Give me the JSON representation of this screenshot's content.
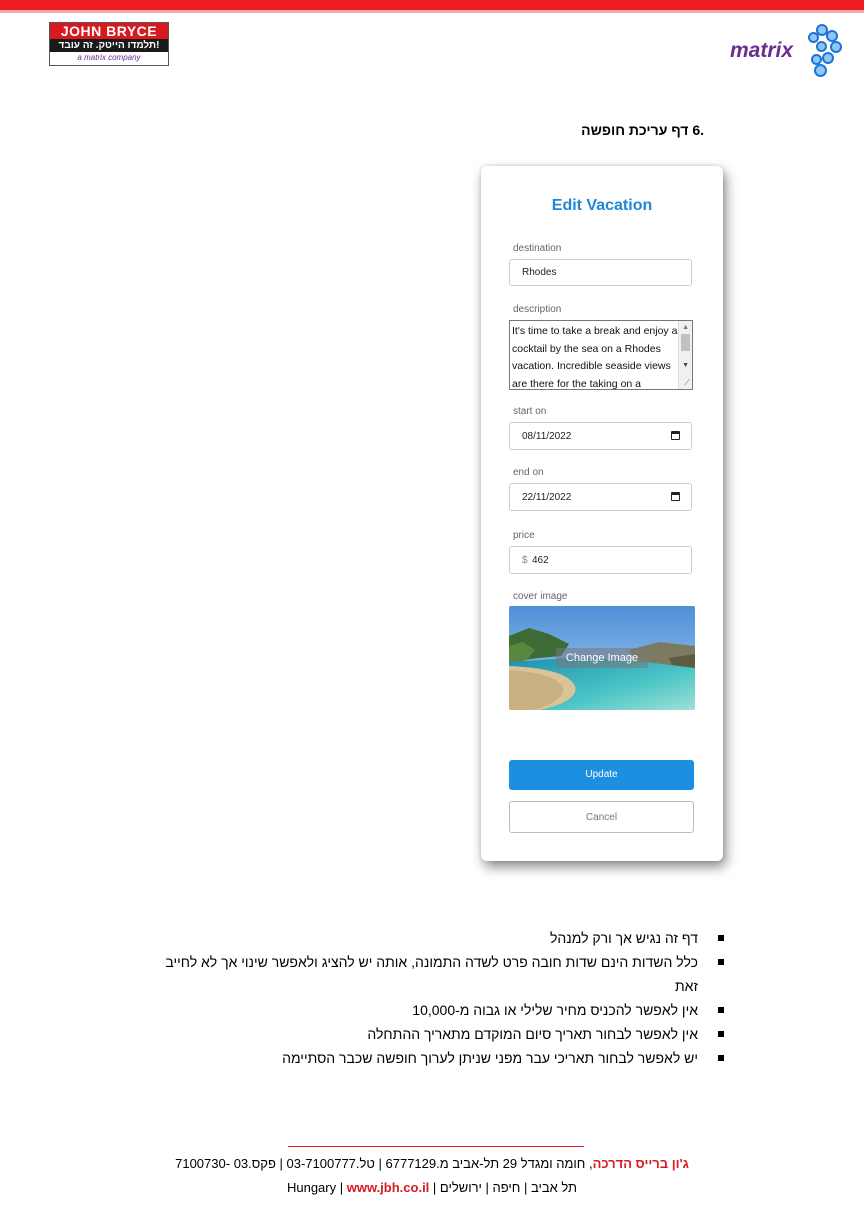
{
  "header": {
    "jb_logo_title": "JOHN BRYCE",
    "jb_logo_tagline": "תלמדו הייטק. זה עובד!",
    "jb_logo_company": "a matrix company",
    "matrix_logo": "matrix"
  },
  "section_heading": ".6   דף עריכת חופשה",
  "screenshot": {
    "title": "Edit Vacation",
    "destination": {
      "label": "destination",
      "value": "Rhodes"
    },
    "description": {
      "label": "description",
      "value": "It's time to take a break and enjoy a cocktail by the sea on a Rhodes vacation. Incredible seaside views are there for the taking on a"
    },
    "start_on": {
      "label": "start on",
      "value": "08/11/2022"
    },
    "end_on": {
      "label": "end on",
      "value": "22/11/2022"
    },
    "price": {
      "label": "price",
      "currency": "$",
      "value": "462"
    },
    "cover_image": {
      "label": "cover image",
      "change_label": "Change Image"
    },
    "update_label": "Update",
    "cancel_label": "Cancel"
  },
  "bullets": [
    "דף זה נגיש אך ורק למנהל",
    "כלל השדות הינם שדות חובה פרט לשדה התמונה, אותה יש להציג ולאפשר שינוי אך לא לחייב זאת",
    "אין לאפשר להכניס מחיר שלילי או גבוה מ-10,000",
    "אין לאפשר לבחור תאריך סיום המוקדם מתאריך ההתחלה",
    "יש לאפשר לבחור תאריכי עבר מפני שניתן לערוך חופשה שכבר הסתיימה"
  ],
  "footer": {
    "company": "ג'ון ברייס הדרכה",
    "address": ", חומה ומגדל 29 תל-אביב  מ.6777129",
    "phone": " | טל.03-7100777 | ",
    "fax": "פקס.03 -7100730",
    "cities": "תל אביב | חיפה | ירושלים  | Hungary | ",
    "website": "www.jbh.co.il"
  }
}
